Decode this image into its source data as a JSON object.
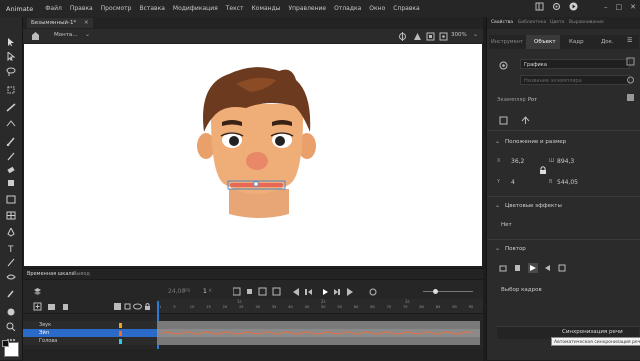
{
  "app": {
    "name": "Animate"
  },
  "menu": [
    "Файл",
    "Правка",
    "Просмотр",
    "Вставка",
    "Модификация",
    "Текст",
    "Команды",
    "Управление",
    "Отладка",
    "Окно",
    "Справка"
  ],
  "document": {
    "tab": "Безымянный-1*",
    "scene": "Монта...",
    "zoom": "300%"
  },
  "panels": {
    "tabs": [
      "Свойства",
      "Библиотека",
      "Цвета",
      "Выравнивание"
    ],
    "subtabs": [
      "Инструмент",
      "Объект",
      "Кадр",
      "Док."
    ],
    "symbol_type": "Графика",
    "instance_placeholder": "Название экземпляра",
    "instance_of_label": "Экземпляр",
    "instance_of_value": "Рот",
    "position_size": {
      "title": "Положение и размер",
      "x_label": "X",
      "x": "36,2",
      "w_label": "Ш",
      "w": "894,3",
      "y_label": "Y",
      "y": "4",
      "h_label": "В",
      "h": "544,05"
    },
    "color_effects": {
      "title": "Цветовые эффекты",
      "value": "Нет"
    },
    "loop": {
      "title": "Повтор",
      "frame_picker": "Выбор кадров"
    },
    "lip_sync_button": "Синхронизация речи",
    "tooltip": "Автоматическая синхронизация речи"
  },
  "timeline": {
    "tabs": [
      "Временная шкала",
      "Вывод"
    ],
    "fps": "24,00",
    "fps_unit": "FPS",
    "current_frame": "1",
    "frame_unit": "К",
    "ruler_marks": [
      "1s",
      "2s",
      "3s"
    ],
    "frame_numbers": [
      "1",
      "5",
      "10",
      "15",
      "20",
      "25",
      "30",
      "35",
      "40",
      "45",
      "50",
      "55",
      "60",
      "65",
      "70",
      "75",
      "80",
      "85",
      "90",
      "95",
      "100"
    ],
    "layers": [
      {
        "name": "Звук",
        "color": "#f0a020"
      },
      {
        "name": "Эйп",
        "color": "#f07020"
      },
      {
        "name": "Голова",
        "color": "#30c8e8"
      }
    ]
  },
  "colors": {
    "accent": "#2a7bd6",
    "stage": "#ffffff",
    "bg": "#1d1d1d",
    "mouth": "#e86858"
  }
}
